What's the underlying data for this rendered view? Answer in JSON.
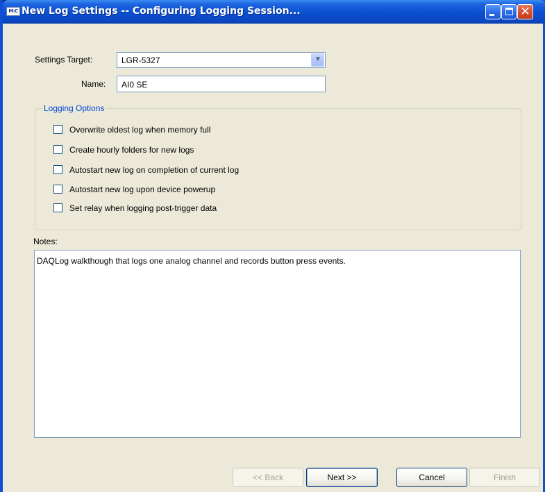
{
  "window": {
    "icon_text": "M:C",
    "title": "New Log Settings -- Configuring Logging Session..."
  },
  "form": {
    "settings_target_label": "Settings Target:",
    "settings_target_value": "LGR-5327",
    "name_label": "Name:",
    "name_value": "AI0 SE"
  },
  "logging_options": {
    "title": "Logging Options",
    "options": [
      {
        "label": "Overwrite oldest log when memory full",
        "checked": false
      },
      {
        "label": "Create hourly folders for new logs",
        "checked": false
      },
      {
        "label": "Autostart new log on completion of current log",
        "checked": false
      },
      {
        "label": "Autostart new log upon device powerup",
        "checked": false
      },
      {
        "label": "Set relay when logging post-trigger data",
        "checked": false
      }
    ]
  },
  "notes": {
    "label": "Notes:",
    "text": "DAQLog walkthough that logs one analog channel and records button press events."
  },
  "buttons": {
    "back": "<< Back",
    "next": "Next >>",
    "cancel": "Cancel",
    "finish": "Finish"
  }
}
